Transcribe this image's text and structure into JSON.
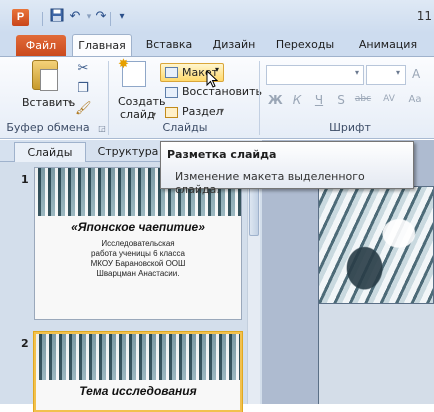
{
  "window": {
    "title_fragment": "11"
  },
  "quick_access": {
    "app_icon_letter": "P"
  },
  "tabs": {
    "file": "Файл",
    "home": "Главная",
    "insert": "Вставка",
    "design": "Дизайн",
    "transitions": "Переходы",
    "animation": "Анимация"
  },
  "ribbon": {
    "clipboard": {
      "paste_label": "Вставить",
      "group_label": "Буфер обмена"
    },
    "slides": {
      "new_slide_line1": "Создать",
      "new_slide_line2": "слайд",
      "layout_label": "Макет",
      "reset_label": "Восстановить",
      "section_label": "Раздел",
      "group_label": "Слайды"
    },
    "font": {
      "group_label": "Шрифт",
      "buttons": [
        "Ж",
        "К",
        "Ч",
        "S",
        "abc",
        "AV",
        "Aa"
      ]
    }
  },
  "tooltip": {
    "title": "Разметка слайда",
    "description": "Изменение макета выделенного слайда."
  },
  "panel": {
    "tab_slides": "Слайды",
    "tab_outline": "Структура",
    "slides": [
      {
        "number": "1",
        "title": "«Японское чаепитие»",
        "lines": [
          "Исследовательская",
          "работа ученицы 6 класса",
          "МКОУ Барановской ООШ",
          "Шварцман Анастасии."
        ]
      },
      {
        "number": "2",
        "title": "Тема исследования"
      }
    ]
  },
  "colors": {
    "file_tab": "#d05a2a",
    "ribbon_bg": "#e6edf7",
    "selection_border": "#f2c14e"
  }
}
